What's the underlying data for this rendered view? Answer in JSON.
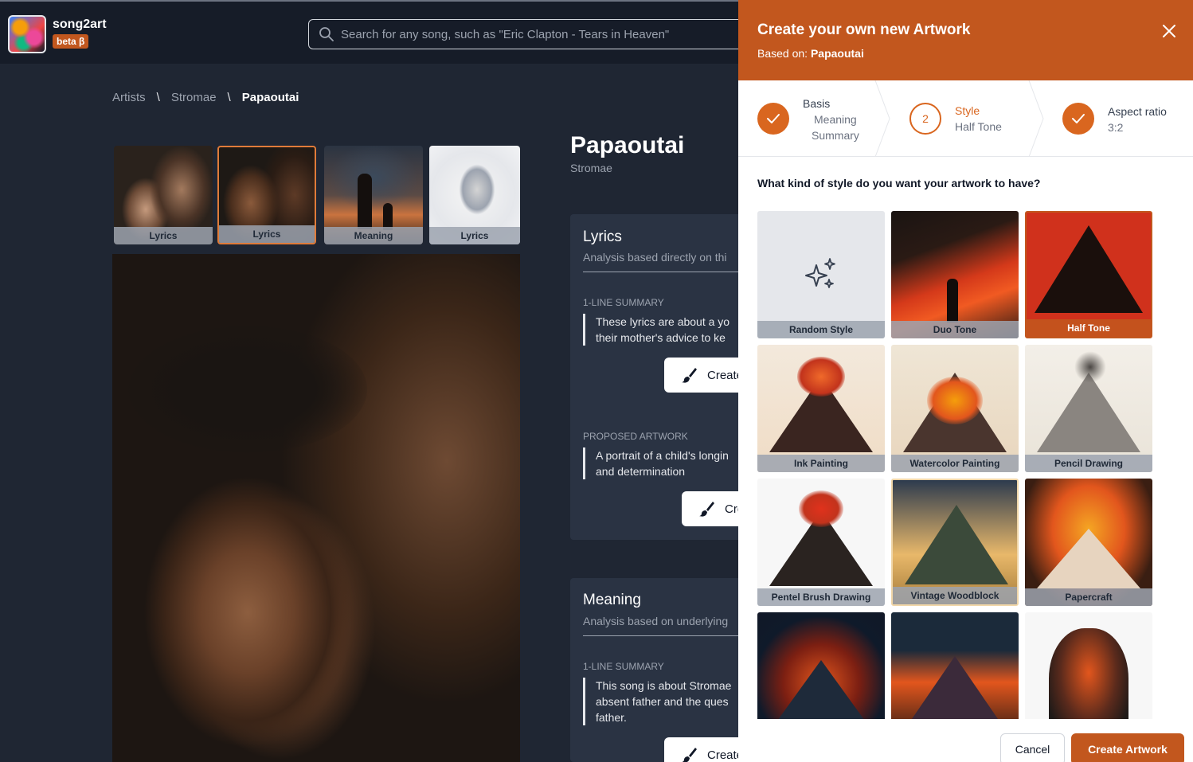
{
  "app": {
    "name": "song2art",
    "badge": "beta β"
  },
  "search": {
    "placeholder": "Search for any song, such as \"Eric Clapton - Tears in Heaven\""
  },
  "breadcrumb": {
    "items": [
      "Artists",
      "\\",
      "Stromae",
      "\\",
      "Papaoutai"
    ]
  },
  "thumbnails": [
    {
      "label": "Lyrics",
      "selected": false
    },
    {
      "label": "Lyrics",
      "selected": true
    },
    {
      "label": "Meaning",
      "selected": false
    },
    {
      "label": "Lyrics",
      "selected": false
    }
  ],
  "song": {
    "title": "Papaoutai",
    "artist": "Stromae"
  },
  "cards": {
    "lyrics": {
      "title": "Lyrics",
      "subtitle": "Analysis based directly on thi",
      "summary_label": "1-LINE SUMMARY",
      "summary_text": [
        "These lyrics are about a yo",
        "their mother's advice to ke"
      ],
      "button1": "Create",
      "proposed_label": "PROPOSED ARTWORK",
      "proposed_text": [
        "A portrait of a child's longin",
        "and determination"
      ],
      "button2": "Cre"
    },
    "meaning": {
      "title": "Meaning",
      "subtitle": "Analysis based on underlying",
      "summary_label": "1-LINE SUMMARY",
      "summary_text": [
        "This song is about Stromae",
        "absent father and the ques",
        "father."
      ],
      "button1": "Create"
    }
  },
  "panel": {
    "title": "Create your own new Artwork",
    "based_on_prefix": "Based on:",
    "based_on_value": "Papaoutai",
    "steps": [
      {
        "name": "Basis",
        "values": [
          "Meaning",
          "Summary"
        ],
        "state": "done"
      },
      {
        "number": "2",
        "name": "Style",
        "values": [
          "Half Tone"
        ],
        "state": "current"
      },
      {
        "name": "Aspect ratio",
        "values": [
          "3:2"
        ],
        "state": "done"
      }
    ],
    "question": "What kind of style do you want your artwork to have?",
    "styles": [
      {
        "label": "Random Style",
        "selected": false
      },
      {
        "label": "Duo Tone",
        "selected": false
      },
      {
        "label": "Half Tone",
        "selected": true
      },
      {
        "label": "Ink Painting",
        "selected": false
      },
      {
        "label": "Watercolor Painting",
        "selected": false
      },
      {
        "label": "Pencil Drawing",
        "selected": false
      },
      {
        "label": "Pentel Brush Drawing",
        "selected": false
      },
      {
        "label": "Vintage Woodblock",
        "selected": false
      },
      {
        "label": "Papercraft",
        "selected": false
      },
      {
        "label": "",
        "selected": false
      },
      {
        "label": "",
        "selected": false
      },
      {
        "label": "",
        "selected": false
      }
    ],
    "cancel_label": "Cancel",
    "create_label": "Create Artwork"
  },
  "colors": {
    "accent": "#c2571e",
    "background": "#1f2633",
    "topbar": "#161c28",
    "card": "#2a3343"
  }
}
